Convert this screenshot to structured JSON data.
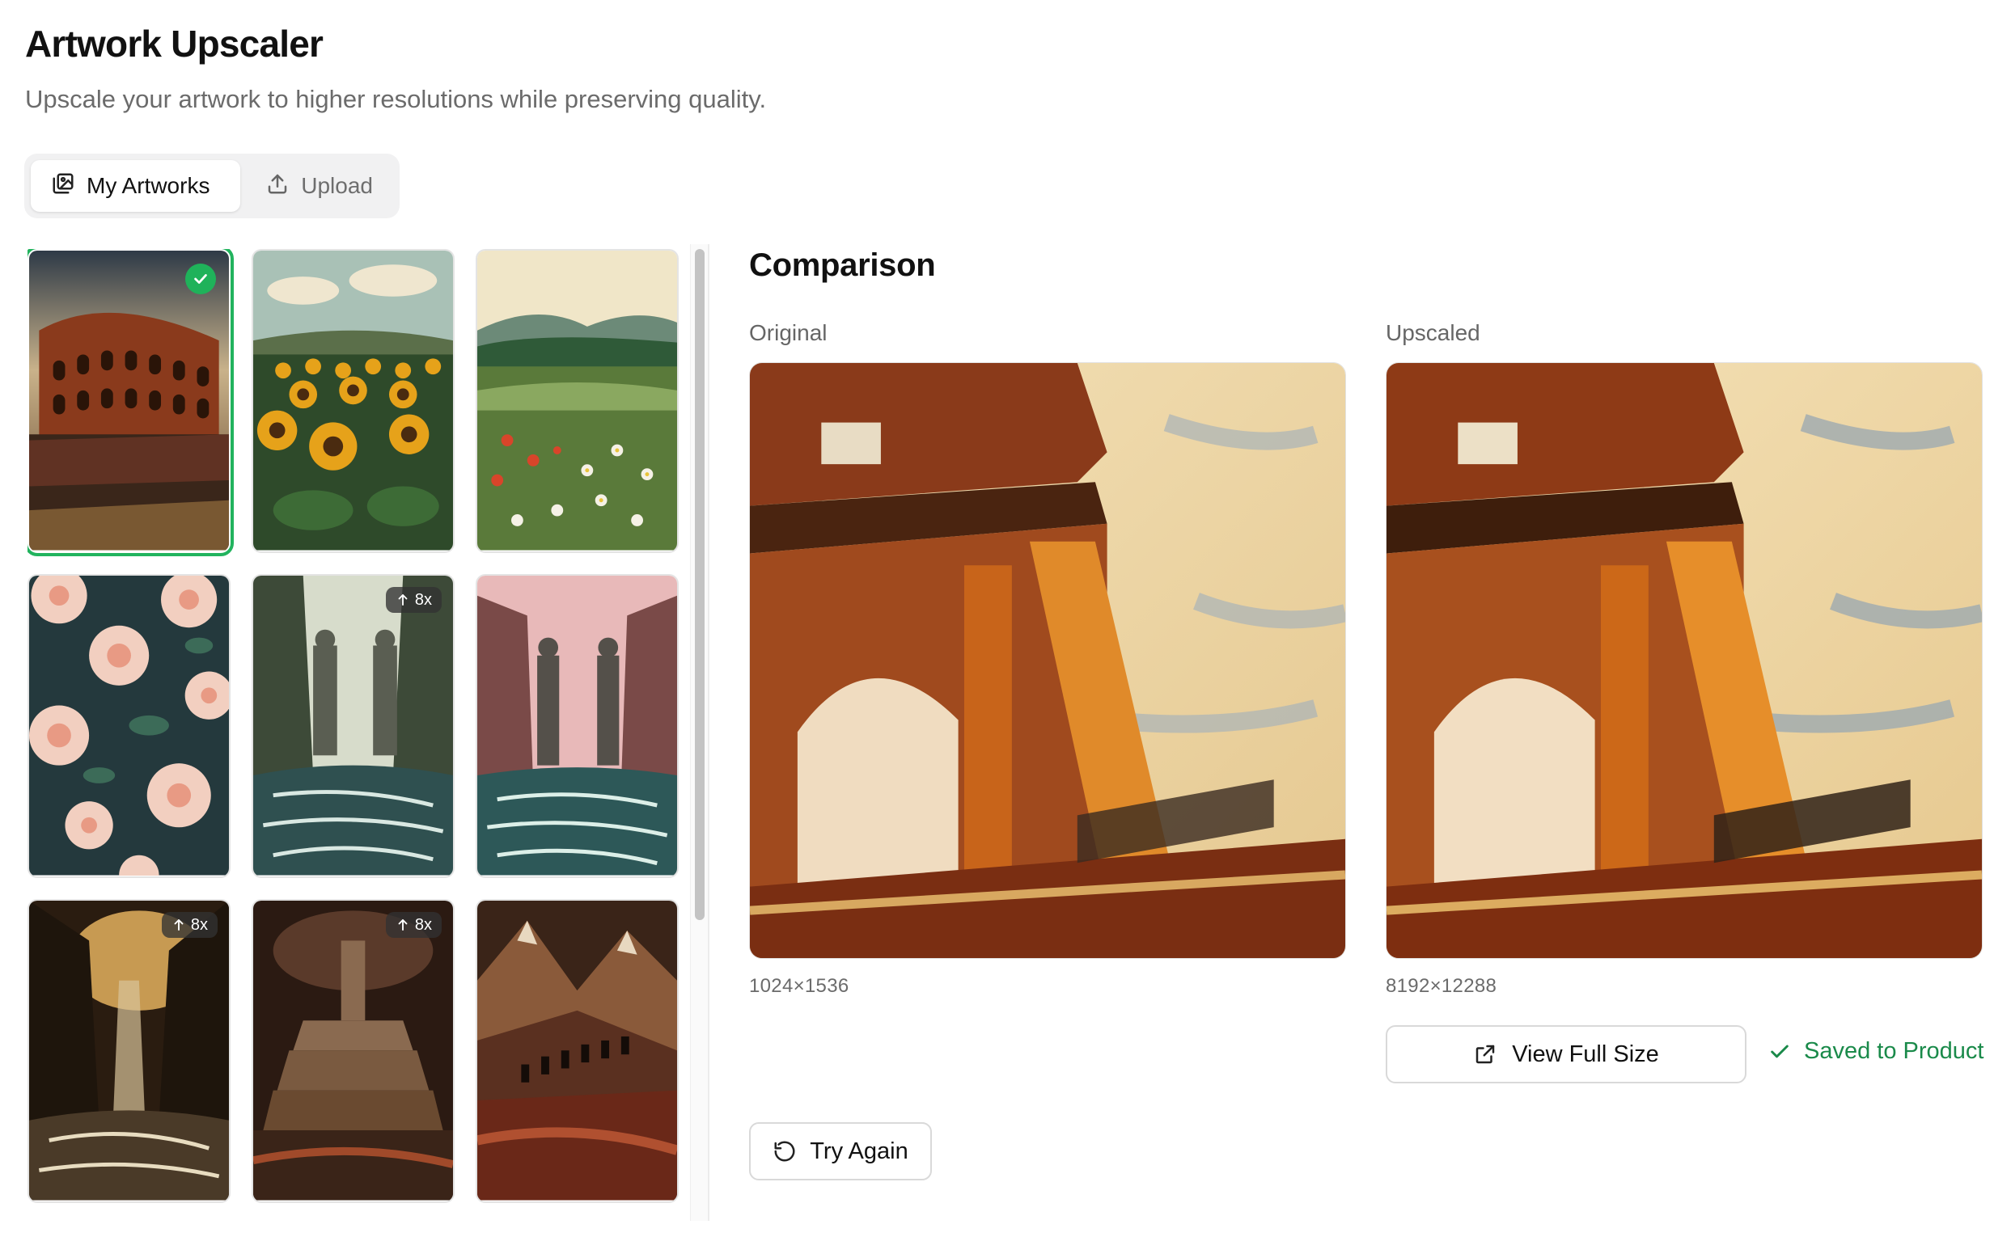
{
  "header": {
    "title": "Artwork Upscaler",
    "subtitle": "Upscale your artwork to higher resolutions while preserving quality."
  },
  "tabs": [
    {
      "label": "My Artworks",
      "icon": "images-icon",
      "active": true
    },
    {
      "label": "Upload",
      "icon": "upload-icon",
      "active": false
    }
  ],
  "gallery": {
    "items": [
      {
        "subject": "colosseum",
        "selected": true,
        "badge": ""
      },
      {
        "subject": "sunflower-field",
        "selected": false,
        "badge": ""
      },
      {
        "subject": "wildflower-meadow",
        "selected": false,
        "badge": ""
      },
      {
        "subject": "peony-pattern",
        "selected": false,
        "badge": ""
      },
      {
        "subject": "river-statues",
        "selected": false,
        "badge": "8x"
      },
      {
        "subject": "river-statues-pink-sky",
        "selected": false,
        "badge": ""
      },
      {
        "subject": "dark-canyon-waterfall",
        "selected": false,
        "badge": "8x"
      },
      {
        "subject": "dark-fortress",
        "selected": false,
        "badge": "8x"
      },
      {
        "subject": "mountain-travellers",
        "selected": false,
        "badge": ""
      }
    ]
  },
  "comparison": {
    "title": "Comparison",
    "original": {
      "label": "Original",
      "dimensions": "1024×1536"
    },
    "upscaled": {
      "label": "Upscaled",
      "dimensions": "8192×12288"
    }
  },
  "actions": {
    "view_full_size": "View Full Size",
    "saved_status": "Saved to Product",
    "try_again": "Try Again"
  },
  "colors": {
    "accent_green": "#1fb25a",
    "saved_text": "#1a8a4a"
  }
}
